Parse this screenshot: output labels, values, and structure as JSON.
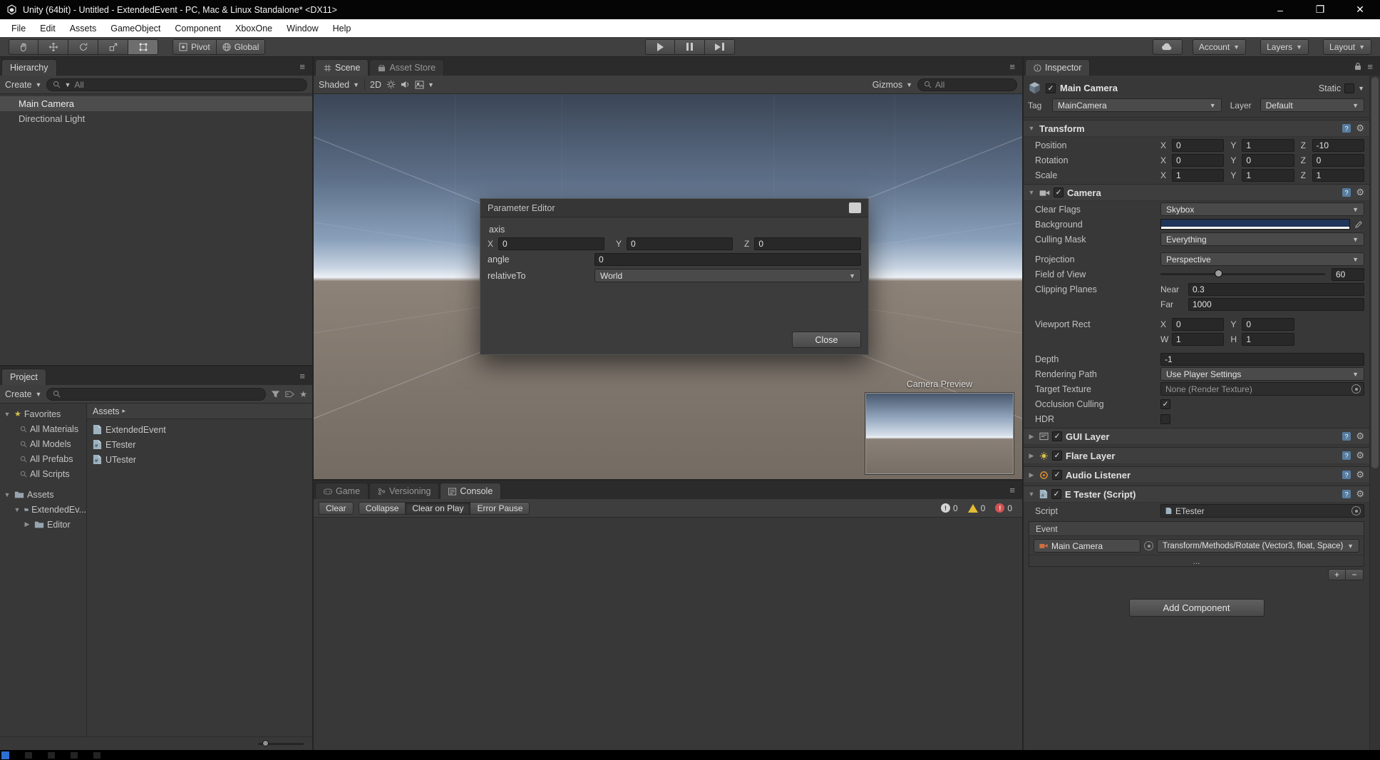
{
  "window": {
    "title": "Unity (64bit) - Untitled - ExtendedEvent - PC, Mac & Linux Standalone* <DX11>"
  },
  "menu": {
    "items": [
      "File",
      "Edit",
      "Assets",
      "GameObject",
      "Component",
      "XboxOne",
      "Window",
      "Help"
    ]
  },
  "toolbar": {
    "pivot": "Pivot",
    "global": "Global",
    "account": "Account",
    "layers": "Layers",
    "layout": "Layout"
  },
  "hierarchy": {
    "tab": "Hierarchy",
    "create": "Create",
    "search": "All",
    "items": [
      {
        "label": "Main Camera"
      },
      {
        "label": "Directional Light"
      }
    ]
  },
  "project": {
    "tab": "Project",
    "create": "Create",
    "favorites": {
      "label": "Favorites",
      "items": [
        "All Materials",
        "All Models",
        "All Prefabs",
        "All Scripts"
      ]
    },
    "root": "Assets",
    "folders": [
      "ExtendedEv...",
      "Editor"
    ],
    "breadcrumb": "Assets",
    "files": [
      "ExtendedEvent",
      "ETester",
      "UTester"
    ]
  },
  "scene": {
    "tab": "Scene",
    "tab_store": "Asset Store",
    "shaded": "Shaded",
    "mode2d": "2D",
    "gizmos": "Gizmos",
    "search": "All",
    "camera_preview": "Camera Preview"
  },
  "dialog": {
    "title": "Parameter Editor",
    "axis": "axis",
    "x": "X",
    "x_value": "0",
    "y": "Y",
    "y_value": "0",
    "z": "Z",
    "z_value": "0",
    "angle": "angle",
    "angle_value": "0",
    "relative_to": "relativeTo",
    "relative_value": "World",
    "close": "Close"
  },
  "console": {
    "tab_game": "Game",
    "tab_versioning": "Versioning",
    "tab_console": "Console",
    "clear": "Clear",
    "collapse": "Collapse",
    "clear_on_play": "Clear on Play",
    "error_pause": "Error Pause",
    "info_count": "0",
    "warn_count": "0",
    "error_count": "0"
  },
  "inspector": {
    "tab": "Inspector",
    "name": "Main Camera",
    "static": "Static",
    "tag_label": "Tag",
    "tag": "MainCamera",
    "layer_label": "Layer",
    "layer": "Default",
    "transform": {
      "title": "Transform",
      "ax": "X",
      "ay": "Y",
      "az": "Z",
      "position": {
        "label": "Position",
        "x": "0",
        "y": "1",
        "z": "-10"
      },
      "rotation": {
        "label": "Rotation",
        "x": "0",
        "y": "0",
        "z": "0"
      },
      "scale": {
        "label": "Scale",
        "x": "1",
        "y": "1",
        "z": "1"
      }
    },
    "camera": {
      "title": "Camera",
      "clear_flags_label": "Clear Flags",
      "clear_flags": "Skybox",
      "background_label": "Background",
      "background_color": "#20355a",
      "background_style": "background:#20355a",
      "culling_label": "Culling Mask",
      "culling": "Everything",
      "projection_label": "Projection",
      "projection": "Perspective",
      "fov_label": "Field of View",
      "fov": "60",
      "clipping_label": "Clipping Planes",
      "near_label": "Near",
      "near": "0.3",
      "far_label": "Far",
      "far": "1000",
      "viewport_label": "Viewport Rect",
      "vx_label": "X",
      "vx": "0",
      "vy_label": "Y",
      "vy": "0",
      "vw_label": "W",
      "vw": "1",
      "vh_label": "H",
      "vh": "1",
      "depth_label": "Depth",
      "depth": "-1",
      "path_label": "Rendering Path",
      "path": "Use Player Settings",
      "texture_label": "Target Texture",
      "texture": "None (Render Texture)",
      "occlusion_label": "Occlusion Culling",
      "hdr_label": "HDR"
    },
    "gui_layer": "GUI Layer",
    "flare_layer": "Flare Layer",
    "audio_listener": "Audio Listener",
    "script": {
      "title": "E Tester (Script)",
      "script_label": "Script",
      "script_value": "ETester",
      "event_label": "Event",
      "target": "Main Camera",
      "method": "Transform/Methods/Rotate (Vector3, float, Space)",
      "more": "...",
      "add": "+",
      "remove": "−"
    },
    "add_component": "Add Component"
  }
}
